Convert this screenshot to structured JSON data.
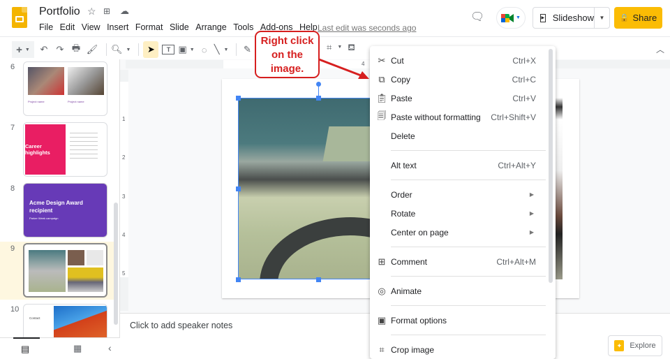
{
  "app": {
    "doc_title": "Portfolio",
    "menus": [
      "File",
      "Edit",
      "View",
      "Insert",
      "Format",
      "Slide",
      "Arrange",
      "Tools",
      "Add-ons",
      "Help"
    ],
    "last_edit": "Last edit was seconds ago",
    "slideshow_label": "Slideshow",
    "share_label": "Share"
  },
  "toolbar": {
    "icons": [
      "new-slide-icon",
      "undo-icon",
      "redo-icon",
      "print-icon",
      "paint-format-icon",
      "zoom-icon",
      "select-icon",
      "text-box-icon",
      "image-icon",
      "shape-icon",
      "line-icon",
      "pen-icon"
    ]
  },
  "sidebar": {
    "slides": [
      {
        "number": "6",
        "title": "Project name",
        "selected": false
      },
      {
        "number": "7",
        "title": "Career highlights",
        "selected": false
      },
      {
        "number": "8",
        "title": "Acme Design Award recipient",
        "subtitle": "Parker Week campaign",
        "selected": false
      },
      {
        "number": "9",
        "title": "",
        "selected": true
      },
      {
        "number": "10",
        "title": "Contact",
        "selected": false
      }
    ]
  },
  "ruler": {
    "h_mark": "4",
    "v_marks": [
      "1",
      "2",
      "3",
      "4",
      "5"
    ]
  },
  "notes": {
    "placeholder": "Click to add speaker notes"
  },
  "explore": {
    "label": "Explore"
  },
  "context_menu": {
    "items": [
      {
        "label": "Cut",
        "shortcut": "Ctrl+X",
        "icon": "cut-icon"
      },
      {
        "label": "Copy",
        "shortcut": "Ctrl+C",
        "icon": "copy-icon"
      },
      {
        "label": "Paste",
        "shortcut": "Ctrl+V",
        "icon": "paste-icon"
      },
      {
        "label": "Paste without formatting",
        "shortcut": "Ctrl+Shift+V",
        "icon": "paste-plain-icon"
      },
      {
        "label": "Delete",
        "shortcut": "",
        "icon": ""
      },
      {
        "label": "Alt text",
        "shortcut": "Ctrl+Alt+Y",
        "icon": ""
      },
      {
        "label": "Order",
        "shortcut": "",
        "submenu": true
      },
      {
        "label": "Rotate",
        "shortcut": "",
        "submenu": true
      },
      {
        "label": "Center on page",
        "shortcut": "",
        "submenu": true
      },
      {
        "label": "Comment",
        "shortcut": "Ctrl+Alt+M",
        "icon": "comment-icon"
      },
      {
        "label": "Animate",
        "shortcut": "",
        "icon": "animate-icon"
      },
      {
        "label": "Format options",
        "shortcut": "",
        "icon": "format-options-icon"
      },
      {
        "label": "Crop image",
        "shortcut": "",
        "icon": "crop-icon"
      }
    ]
  },
  "annotation": {
    "line1": "Right click",
    "line2": "on the",
    "line3": "image.",
    "color": "#d61f1f"
  }
}
